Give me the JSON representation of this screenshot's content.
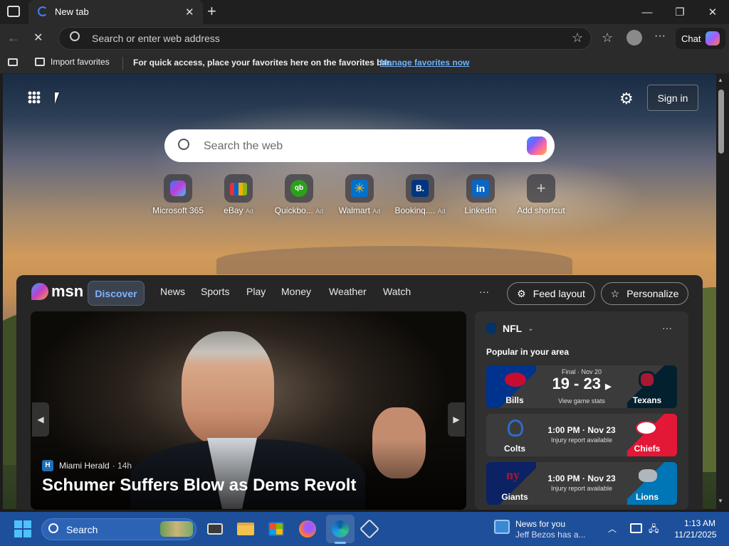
{
  "tab": {
    "title": "New tab"
  },
  "address_bar": {
    "placeholder": "Search or enter web address"
  },
  "toolbar": {
    "chat_label": "Chat"
  },
  "favorites_bar": {
    "import_label": "Import favorites",
    "message": "For quick access, place your favorites here on the favorites bar.",
    "manage_link": "Manage favorites now"
  },
  "page": {
    "signin_label": "Sign in",
    "search_placeholder": "Search the web",
    "shortcuts": [
      {
        "label": "Microsoft 365",
        "ad": "",
        "icon": "microsoft-365-icon"
      },
      {
        "label": "eBay",
        "ad": "Ad",
        "icon": "ebay-icon"
      },
      {
        "label": "Quickbo...",
        "ad": "Ad",
        "icon": "quickbooks-icon"
      },
      {
        "label": "Walmart",
        "ad": "Ad",
        "icon": "walmart-icon"
      },
      {
        "label": "Bookinq....",
        "ad": "Ad",
        "icon": "booking-icon"
      },
      {
        "label": "LinkedIn",
        "ad": "",
        "icon": "linkedin-icon"
      },
      {
        "label": "Add shortcut",
        "ad": "",
        "icon": "plus-icon"
      }
    ]
  },
  "msn": {
    "logo": "msn",
    "tabs": [
      "Discover",
      "News",
      "Sports",
      "Play",
      "Money",
      "Weather",
      "Watch"
    ],
    "more": "···",
    "feed_layout": "Feed layout",
    "personalize": "Personalize",
    "hero": {
      "source": "Miami Herald",
      "age": "· 14h",
      "headline": "Schumer Suffers Blow as Dems Revolt"
    },
    "nfl": {
      "title": "NFL",
      "subtitle": "Popular in your area",
      "games": [
        {
          "home": "Bills",
          "away": "Texans",
          "status": "Final · Nov 20",
          "score": "19 - 23",
          "note": "View game stats"
        },
        {
          "home": "Colts",
          "away": "Chiefs",
          "status": "1:00 PM · Nov 23",
          "score": "",
          "note": "Injury report available"
        },
        {
          "home": "Giants",
          "away": "Lions",
          "status": "1:00 PM · Nov 23",
          "score": "",
          "note": "Injury report available"
        }
      ]
    }
  },
  "taskbar": {
    "search_label": "Search",
    "news_title": "News for you",
    "news_sub": "Jeff Bezos has a...",
    "time": "1:13 AM",
    "date": "11/21/2025"
  }
}
